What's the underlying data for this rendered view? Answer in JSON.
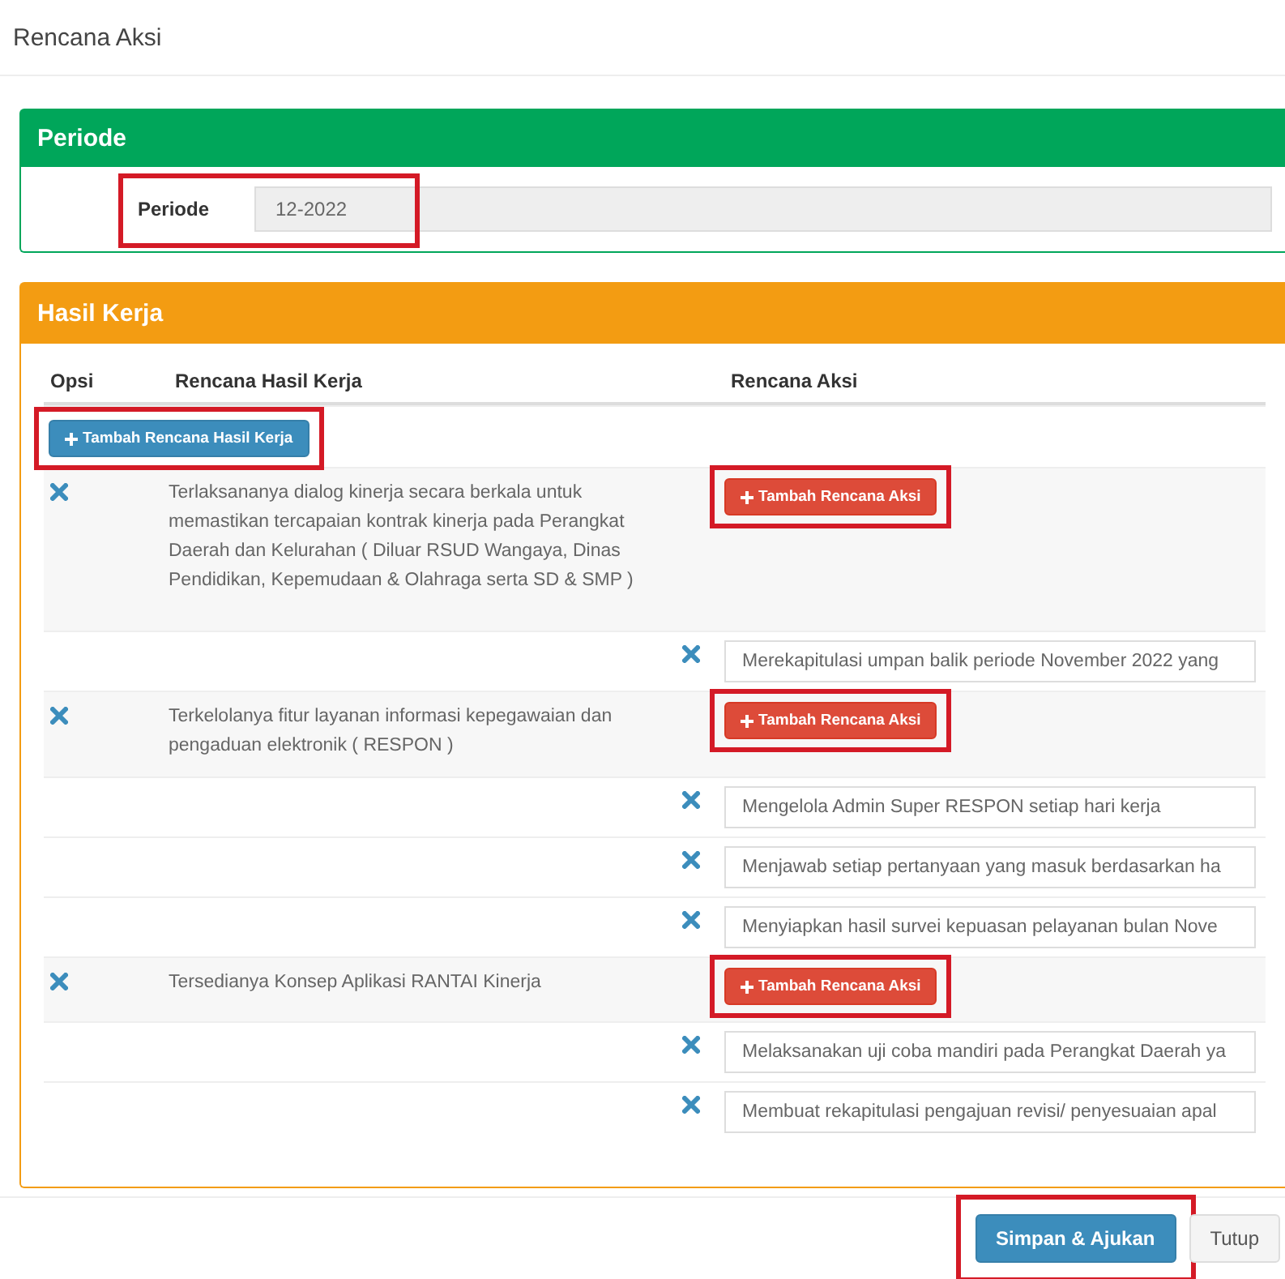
{
  "dialog": {
    "title": "Rencana Aksi"
  },
  "periode_panel": {
    "title": "Periode",
    "label": "Periode",
    "value": "12-2022",
    "highlighted": true
  },
  "hasil_kerja_panel": {
    "title": "Hasil Kerja",
    "columns": [
      "Opsi",
      "Rencana Hasil Kerja",
      "Rencana Aksi"
    ],
    "add_button": {
      "label": "Tambah Rencana Hasil Kerja",
      "highlighted": true
    },
    "rows": [
      {
        "kind": "hasil",
        "text": "Terlaksananya dialog kinerja secara berkala untuk memastikan tercapaian kontrak kinerja pada Perangkat Daerah dan Kelurahan ( Diluar RSUD Wangaya, Dinas Pendidikan, Kepemudaan & Olahraga serta SD & SMP )",
        "button": "Tambah Rencana Aksi",
        "highlighted": true
      },
      {
        "kind": "aksi",
        "value": "Merekapitulasi umpan balik periode November 2022 yang"
      },
      {
        "kind": "hasil",
        "text": "Terkelolanya fitur layanan informasi kepegawaian dan pengaduan elektronik ( RESPON )",
        "button": "Tambah Rencana Aksi",
        "highlighted": true
      },
      {
        "kind": "aksi",
        "value": "Mengelola Admin Super RESPON setiap hari kerja"
      },
      {
        "kind": "aksi",
        "value": "Menjawab setiap pertanyaan yang masuk berdasarkan ha"
      },
      {
        "kind": "aksi",
        "value": "Menyiapkan hasil survei kepuasan pelayanan bulan Nove"
      },
      {
        "kind": "hasil",
        "text": "Tersedianya Konsep Aplikasi RANTAI Kinerja",
        "button": "Tambah Rencana Aksi",
        "highlighted": true
      },
      {
        "kind": "aksi",
        "value": "Melaksanakan uji coba mandiri pada Perangkat Daerah ya"
      },
      {
        "kind": "aksi",
        "value": "Membuat rekapitulasi pengajuan revisi/ penyesuaian apal"
      }
    ]
  },
  "footer_buttons": [
    {
      "label": "Simpan & Ajukan",
      "kind": "primary",
      "highlighted": true
    },
    {
      "label": "Tutup",
      "kind": "default",
      "highlighted": false
    }
  ]
}
